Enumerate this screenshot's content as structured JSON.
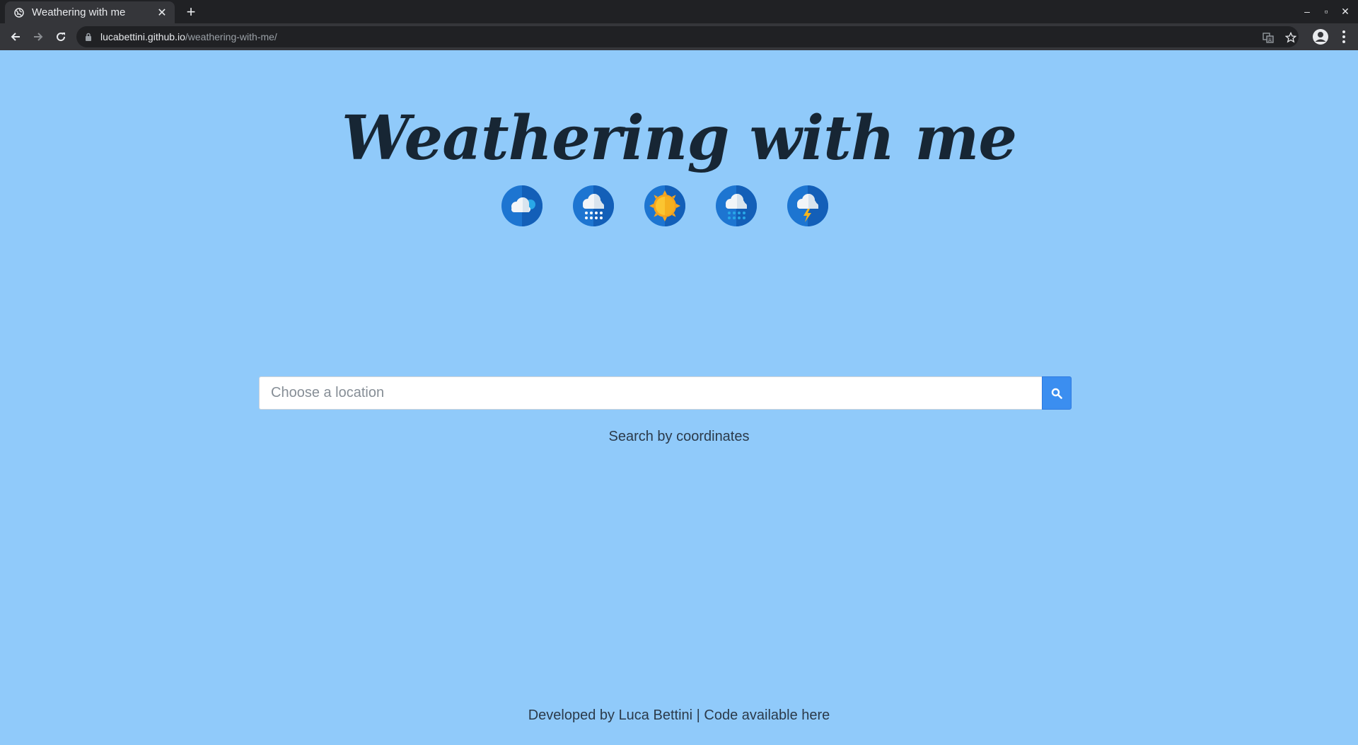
{
  "browser": {
    "tab_title": "Weathering with me",
    "url_host": "lucabettini.github.io",
    "url_path": "/weathering-with-me/"
  },
  "header": {
    "title": "Weathering with me",
    "weather_icons": [
      "cloudy-icon",
      "snow-icon",
      "sun-icon",
      "rain-icon",
      "thunderstorm-icon"
    ]
  },
  "search": {
    "placeholder": "Choose a location",
    "value": "",
    "coords_link": "Search by coordinates"
  },
  "footer": {
    "text_prefix": "Developed by ",
    "author": "Luca Bettini",
    "separator": " | ",
    "code_link": "Code available here"
  },
  "colors": {
    "page_bg": "#90cafa",
    "title": "#172634",
    "search_button": "#3b8ef0",
    "icon_circle": "#1976d2"
  }
}
